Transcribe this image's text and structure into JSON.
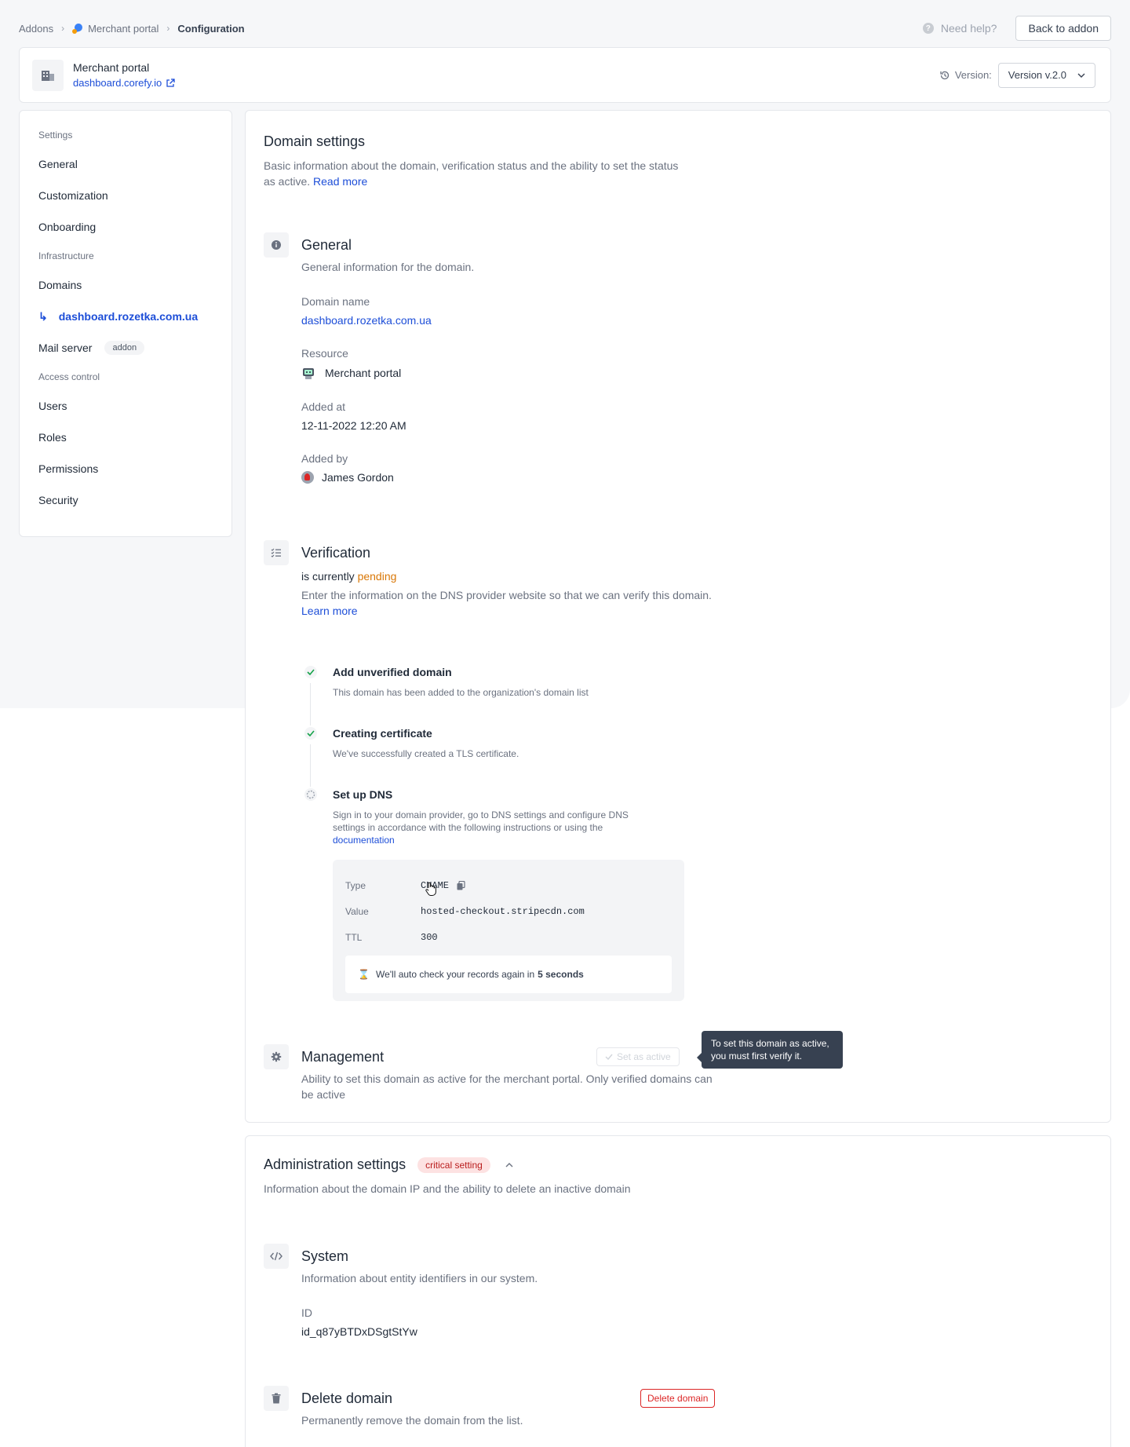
{
  "breadcrumb": {
    "addons": "Addons",
    "portal": "Merchant portal",
    "current": "Configuration"
  },
  "top": {
    "help": "Need help?",
    "back": "Back to addon"
  },
  "header": {
    "title": "Merchant portal",
    "link": "dashboard.corefy.io",
    "version_label": "Version:",
    "version_value": "Version v.2.0"
  },
  "sidebar": {
    "group_settings": "Settings",
    "general": "General",
    "customization": "Customization",
    "onboarding": "Onboarding",
    "group_infrastructure": "Infrastructure",
    "domains": "Domains",
    "active_domain": "dashboard.rozetka.com.ua",
    "mail_server": "Mail server",
    "mail_badge": "addon",
    "group_access": "Access control",
    "users": "Users",
    "roles": "Roles",
    "permissions": "Permissions",
    "security": "Security"
  },
  "domain_settings": {
    "title": "Domain settings",
    "desc": "Basic information about the domain, verification status and the ability to set the status as active.",
    "read_more": "Read more"
  },
  "general": {
    "title": "General",
    "desc": "General information for the domain.",
    "domain_label": "Domain name",
    "domain_value": "dashboard.rozetka.com.ua",
    "resource_label": "Resource",
    "resource_value": "Merchant portal",
    "added_at_label": "Added at",
    "added_at_value": "12-11-2022 12:20 AM",
    "added_by_label": "Added by",
    "added_by_value": "James Gordon"
  },
  "verification": {
    "title": "Verification",
    "status_prefix": "is currently",
    "status": "pending",
    "desc": "Enter the information on the DNS provider website so that we can verify this domain.",
    "learn_more": "Learn more",
    "steps": [
      {
        "title": "Add unverified domain",
        "desc": "This domain has been added to the organization's domain list"
      },
      {
        "title": "Creating certificate",
        "desc": "We've successfully created a TLS certificate."
      },
      {
        "title": "Set up DNS",
        "desc": "Sign in to your domain provider, go to DNS settings and configure DNS settings in accordance with the following instructions or using the",
        "link": "documentation"
      }
    ],
    "dns": {
      "type_label": "Type",
      "type_value": "CNAME",
      "value_label": "Value",
      "value_value": "hosted-checkout.stripecdn.com",
      "ttl_label": "TTL",
      "ttl_value": "300",
      "note": "We'll auto check your records again in",
      "note_bold": "5 seconds"
    }
  },
  "management": {
    "title": "Management",
    "desc": "Ability to set this domain as active for the merchant portal. Only verified domains can be active",
    "button": "Set as active",
    "tooltip": "To set this domain as active, you must first verify it."
  },
  "admin": {
    "title": "Administration settings",
    "badge": "critical setting",
    "desc": "Information about the domain IP and the ability to delete an inactive domain"
  },
  "system": {
    "title": "System",
    "desc": "Information about entity identifiers in our system.",
    "id_label": "ID",
    "id_value": "id_q87yBTDxDSgtStYw"
  },
  "delete": {
    "title": "Delete domain",
    "desc": "Permanently remove the domain from the list.",
    "button": "Delete domain"
  },
  "colors": {
    "accent": "#1d4ed8",
    "pending": "#d97706",
    "success": "#16a34a",
    "danger": "#dc2626"
  }
}
